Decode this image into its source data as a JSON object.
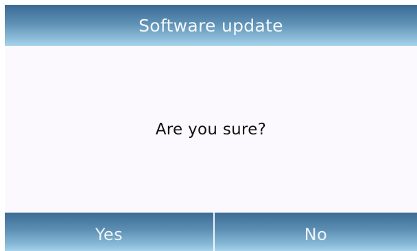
{
  "dialog": {
    "title": "Software update",
    "message": "Are you sure?",
    "buttons": {
      "yes_label": "Yes",
      "no_label": "No"
    }
  },
  "colors": {
    "header_dark": "#3a6a93",
    "header_light": "#a9d5ec",
    "body_background": "#fbf9fd",
    "message_text": "#111111",
    "header_text": "#f4f8fb"
  }
}
